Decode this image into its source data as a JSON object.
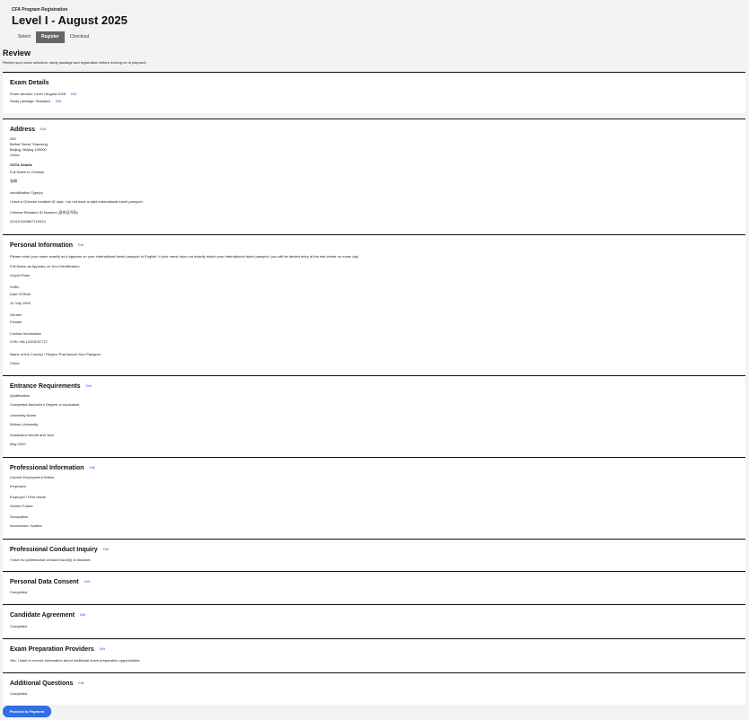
{
  "header": {
    "program": "CFA Program Registration",
    "title": "Level I - August 2025",
    "steps": [
      "Select",
      "Register",
      "Checkout"
    ]
  },
  "review": {
    "title": "Review",
    "subtitle": "Review your exam selection, study package and registration before moving on to payment."
  },
  "edit_label": "Edit",
  "exam": {
    "title": "Exam Details",
    "window": "Exam window: Level I August 2025",
    "package": "Study package: Standard"
  },
  "address": {
    "title": "Address",
    "lines": [
      "250",
      "Beihai Street, Shaoxing",
      "Beijing, Beijing 100000",
      "China"
    ],
    "osta": "OSTA Details",
    "full_name_label": "Full Name in Chinese",
    "full_name_value": "张琳",
    "id_type_label": "Identification Type(s)",
    "id_type_value": "I have a Chinese resident ID card. I do not have a valid international travel passport.",
    "id_number_label": "Chinese Resident ID Number (身份证号码)",
    "id_number_value": "310101199807120314"
  },
  "personal": {
    "title": "Personal Information",
    "note": "Please enter your name exactly as it appears on your international travel passport in English. If your name does not exactly match your international travel passport, you will be denied entry at the test center on exam day.",
    "name_label": "Full Name as Appears on Your Identification",
    "name_value": "Linyan Ruan",
    "suffix_label": "Suffix",
    "dob_label": "Date Of Birth",
    "dob_value": "12 July 1998",
    "gender_label": "Gender",
    "gender_value": "Female",
    "contact_label": "Contact Information",
    "contact_value": "CHN +86 13328787717",
    "country_label": "Name of the Country / Region That Issued Your Passport",
    "country_value": "China"
  },
  "entrance": {
    "title": "Entrance Requirements",
    "qual_label": "Qualification",
    "qual_value": "Completed Bachelor's Degree or equivalent",
    "uni_label": "University Name",
    "uni_value": "Wuhan University",
    "grad_label": "Graduation Month and Year",
    "grad_value": "May 2020"
  },
  "professional": {
    "title": "Professional Information",
    "status_label": "Current Employment Status",
    "status_value": "Employed",
    "firm_label": "Employer / Firm Name",
    "firm_value": "Golden Future",
    "occ_label": "Occupation",
    "occ_value": "Accountant / Auditor"
  },
  "conduct": {
    "title": "Professional Conduct Inquiry",
    "value": "I have no professional conduct issue(s) to disclose."
  },
  "consent": {
    "title": "Personal Data Consent",
    "value": "Completed"
  },
  "agreement": {
    "title": "Candidate Agreement",
    "value": "Completed"
  },
  "providers": {
    "title": "Exam Preparation Providers",
    "value": "Yes, I want to receive information about additional exam preparation opportunities."
  },
  "additional": {
    "title": "Additional Questions",
    "value": "Completed"
  },
  "proceed_label": "Proceed to Payment"
}
